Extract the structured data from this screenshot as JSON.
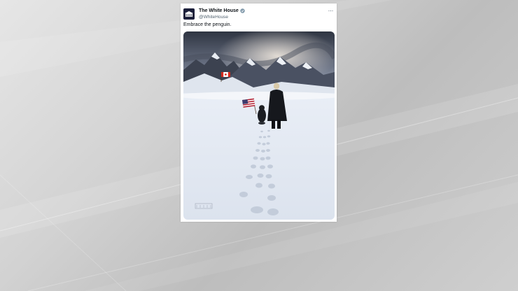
{
  "post": {
    "author_name": "The White House",
    "handle": "@WhiteHouse",
    "text": "Embrace the penguin.",
    "more_label": "···",
    "verified_icon": "verified-badge-icon",
    "watermark": "THE WHITE HOUSE"
  },
  "colors": {
    "accent": "#1d9bf0",
    "text_primary": "#0f1419",
    "text_secondary": "#536471"
  }
}
